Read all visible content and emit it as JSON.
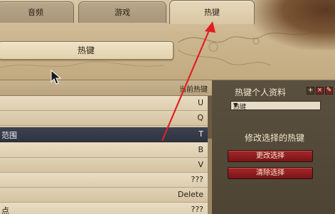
{
  "tabs": [
    {
      "label": "音频",
      "active": false
    },
    {
      "label": "游戏",
      "active": false
    },
    {
      "label": "热键",
      "active": true
    }
  ],
  "section": {
    "title": "热键"
  },
  "list": {
    "header_label": "当前热键",
    "rows": [
      {
        "name": "",
        "key": "U"
      },
      {
        "name": "",
        "key": "Q"
      },
      {
        "name": "范围",
        "key": "T",
        "selected": true
      },
      {
        "name": "",
        "key": "B"
      },
      {
        "name": "",
        "key": "V"
      },
      {
        "name": "",
        "key": "???"
      },
      {
        "name": "",
        "key": "Delete"
      },
      {
        "name": "点",
        "key": "???"
      }
    ]
  },
  "profile": {
    "title": "热键个人资料",
    "dropdown_value": "热键",
    "icons": {
      "add": "plus-icon",
      "delete": "x-icon",
      "edit": "pencil-icon"
    }
  },
  "modify": {
    "title": "修改选择的热键",
    "change_label": "更改选择",
    "clear_label": "清除选择"
  },
  "colors": {
    "accent_red": "#a4282a",
    "selected_row": "#3c4250",
    "annotation_arrow": "#e02020"
  }
}
